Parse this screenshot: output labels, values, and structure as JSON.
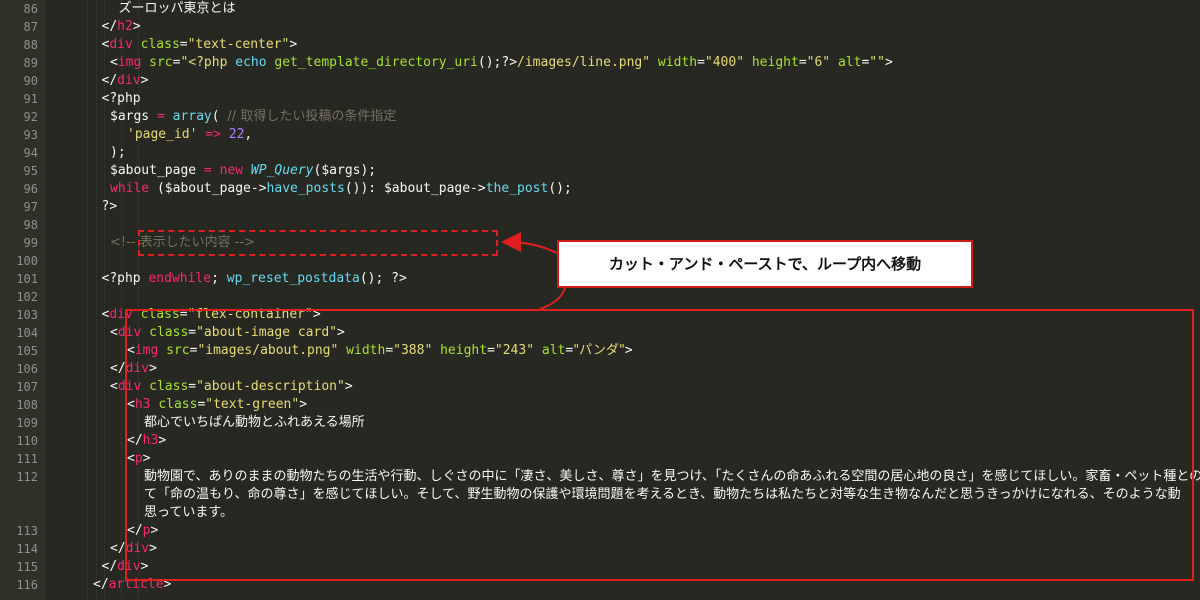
{
  "editor": {
    "lines": [
      {
        "n": "86",
        "indent": 9,
        "tokens": [
          {
            "t": "text",
            "v": "ズーロッパ東京とは"
          }
        ]
      },
      {
        "n": "87",
        "indent": 7,
        "tokens": [
          {
            "t": "punct",
            "v": "</"
          },
          {
            "t": "tag",
            "v": "h2"
          },
          {
            "t": "punct",
            "v": ">"
          }
        ]
      },
      {
        "n": "88",
        "indent": 7,
        "tokens": [
          {
            "t": "punct",
            "v": "<"
          },
          {
            "t": "tag",
            "v": "div"
          },
          {
            "t": "punct",
            "v": " "
          },
          {
            "t": "attr",
            "v": "class"
          },
          {
            "t": "punct",
            "v": "="
          },
          {
            "t": "str",
            "v": "\"text-center\""
          },
          {
            "t": "punct",
            "v": ">"
          }
        ]
      },
      {
        "n": "89",
        "indent": 8,
        "tokens": [
          {
            "t": "punct",
            "v": "<"
          },
          {
            "t": "tag",
            "v": "img"
          },
          {
            "t": "punct",
            "v": " "
          },
          {
            "t": "attr",
            "v": "src"
          },
          {
            "t": "punct",
            "v": "="
          },
          {
            "t": "str",
            "v": "\"<?php "
          },
          {
            "t": "fn",
            "v": "echo"
          },
          {
            "t": "punct",
            "v": " "
          },
          {
            "t": "attr",
            "v": "get_template_directory_uri"
          },
          {
            "t": "punct",
            "v": "();?>"
          },
          {
            "t": "str",
            "v": "/images/line.png\""
          },
          {
            "t": "punct",
            "v": " "
          },
          {
            "t": "attr",
            "v": "width"
          },
          {
            "t": "punct",
            "v": "="
          },
          {
            "t": "str",
            "v": "\"400\""
          },
          {
            "t": "punct",
            "v": " "
          },
          {
            "t": "attr",
            "v": "height"
          },
          {
            "t": "punct",
            "v": "="
          },
          {
            "t": "str",
            "v": "\"6\""
          },
          {
            "t": "punct",
            "v": " "
          },
          {
            "t": "attr",
            "v": "alt"
          },
          {
            "t": "punct",
            "v": "="
          },
          {
            "t": "str",
            "v": "\"\""
          },
          {
            "t": "punct",
            "v": ">"
          }
        ]
      },
      {
        "n": "90",
        "indent": 7,
        "tokens": [
          {
            "t": "punct",
            "v": "</"
          },
          {
            "t": "tag",
            "v": "div"
          },
          {
            "t": "punct",
            "v": ">"
          }
        ]
      },
      {
        "n": "91",
        "indent": 7,
        "tokens": [
          {
            "t": "php",
            "v": "<?php"
          }
        ]
      },
      {
        "n": "92",
        "indent": 8,
        "tokens": [
          {
            "t": "var",
            "v": "$args"
          },
          {
            "t": "punct",
            "v": " "
          },
          {
            "t": "kw",
            "v": "="
          },
          {
            "t": "punct",
            "v": " "
          },
          {
            "t": "fn",
            "v": "array"
          },
          {
            "t": "punct",
            "v": "( "
          },
          {
            "t": "comment",
            "v": "// 取得したい投稿の条件指定"
          }
        ]
      },
      {
        "n": "93",
        "indent": 10,
        "tokens": [
          {
            "t": "str",
            "v": "'page_id'"
          },
          {
            "t": "punct",
            "v": " "
          },
          {
            "t": "kw",
            "v": "=>"
          },
          {
            "t": "punct",
            "v": " "
          },
          {
            "t": "num",
            "v": "22"
          },
          {
            "t": "punct",
            "v": ","
          }
        ]
      },
      {
        "n": "94",
        "indent": 8,
        "tokens": [
          {
            "t": "punct",
            "v": ");"
          }
        ]
      },
      {
        "n": "95",
        "indent": 8,
        "tokens": [
          {
            "t": "var",
            "v": "$about_page"
          },
          {
            "t": "punct",
            "v": " "
          },
          {
            "t": "kw",
            "v": "="
          },
          {
            "t": "punct",
            "v": " "
          },
          {
            "t": "kw",
            "v": "new"
          },
          {
            "t": "punct",
            "v": " "
          },
          {
            "t": "cls",
            "v": "WP_Query"
          },
          {
            "t": "punct",
            "v": "($args);"
          }
        ]
      },
      {
        "n": "96",
        "indent": 8,
        "tokens": [
          {
            "t": "kw",
            "v": "while"
          },
          {
            "t": "punct",
            "v": " ($about_page->"
          },
          {
            "t": "fn",
            "v": "have_posts"
          },
          {
            "t": "punct",
            "v": "()): $about_page->"
          },
          {
            "t": "fn",
            "v": "the_post"
          },
          {
            "t": "punct",
            "v": "();"
          }
        ]
      },
      {
        "n": "97",
        "indent": 7,
        "tokens": [
          {
            "t": "php",
            "v": "?>"
          }
        ]
      },
      {
        "n": "98",
        "indent": 0,
        "tokens": []
      },
      {
        "n": "99",
        "indent": 8,
        "tokens": [
          {
            "t": "comment",
            "v": "<!-- 表示したい内容 -->"
          }
        ]
      },
      {
        "n": "100",
        "indent": 0,
        "tokens": []
      },
      {
        "n": "101",
        "indent": 7,
        "tokens": [
          {
            "t": "php",
            "v": "<?php "
          },
          {
            "t": "kw",
            "v": "endwhile"
          },
          {
            "t": "punct",
            "v": "; "
          },
          {
            "t": "fn",
            "v": "wp_reset_postdata"
          },
          {
            "t": "punct",
            "v": "(); ?>"
          }
        ]
      },
      {
        "n": "102",
        "indent": 0,
        "tokens": []
      },
      {
        "n": "103",
        "indent": 7,
        "tokens": [
          {
            "t": "punct",
            "v": "<"
          },
          {
            "t": "tag",
            "v": "div"
          },
          {
            "t": "punct",
            "v": " "
          },
          {
            "t": "attr",
            "v": "class"
          },
          {
            "t": "punct",
            "v": "="
          },
          {
            "t": "str",
            "v": "\"flex-container\""
          },
          {
            "t": "punct",
            "v": ">"
          }
        ]
      },
      {
        "n": "104",
        "indent": 8,
        "tokens": [
          {
            "t": "punct",
            "v": "<"
          },
          {
            "t": "tag",
            "v": "div"
          },
          {
            "t": "punct",
            "v": " "
          },
          {
            "t": "attr",
            "v": "class"
          },
          {
            "t": "punct",
            "v": "="
          },
          {
            "t": "str",
            "v": "\"about-image card\""
          },
          {
            "t": "punct",
            "v": ">"
          }
        ]
      },
      {
        "n": "105",
        "indent": 10,
        "tokens": [
          {
            "t": "punct",
            "v": "<"
          },
          {
            "t": "tag",
            "v": "img"
          },
          {
            "t": "punct",
            "v": " "
          },
          {
            "t": "attr",
            "v": "src"
          },
          {
            "t": "punct",
            "v": "="
          },
          {
            "t": "str",
            "v": "\"images/about.png\""
          },
          {
            "t": "punct",
            "v": " "
          },
          {
            "t": "attr",
            "v": "width"
          },
          {
            "t": "punct",
            "v": "="
          },
          {
            "t": "str",
            "v": "\"388\""
          },
          {
            "t": "punct",
            "v": " "
          },
          {
            "t": "attr",
            "v": "height"
          },
          {
            "t": "punct",
            "v": "="
          },
          {
            "t": "str",
            "v": "\"243\""
          },
          {
            "t": "punct",
            "v": " "
          },
          {
            "t": "attr",
            "v": "alt"
          },
          {
            "t": "punct",
            "v": "="
          },
          {
            "t": "str",
            "v": "\"パンダ\""
          },
          {
            "t": "punct",
            "v": ">"
          }
        ]
      },
      {
        "n": "106",
        "indent": 8,
        "tokens": [
          {
            "t": "punct",
            "v": "</"
          },
          {
            "t": "tag",
            "v": "div"
          },
          {
            "t": "punct",
            "v": ">"
          }
        ]
      },
      {
        "n": "107",
        "indent": 8,
        "tokens": [
          {
            "t": "punct",
            "v": "<"
          },
          {
            "t": "tag",
            "v": "div"
          },
          {
            "t": "punct",
            "v": " "
          },
          {
            "t": "attr",
            "v": "class"
          },
          {
            "t": "punct",
            "v": "="
          },
          {
            "t": "str",
            "v": "\"about-description\""
          },
          {
            "t": "punct",
            "v": ">"
          }
        ]
      },
      {
        "n": "108",
        "indent": 10,
        "tokens": [
          {
            "t": "punct",
            "v": "<"
          },
          {
            "t": "tag",
            "v": "h3"
          },
          {
            "t": "punct",
            "v": " "
          },
          {
            "t": "attr",
            "v": "class"
          },
          {
            "t": "punct",
            "v": "="
          },
          {
            "t": "str",
            "v": "\"text-green\""
          },
          {
            "t": "punct",
            "v": ">"
          }
        ]
      },
      {
        "n": "109",
        "indent": 12,
        "tokens": [
          {
            "t": "text",
            "v": "都心でいちばん動物とふれあえる場所"
          }
        ]
      },
      {
        "n": "110",
        "indent": 10,
        "tokens": [
          {
            "t": "punct",
            "v": "</"
          },
          {
            "t": "tag",
            "v": "h3"
          },
          {
            "t": "punct",
            "v": ">"
          }
        ]
      },
      {
        "n": "111",
        "indent": 10,
        "tokens": [
          {
            "t": "punct",
            "v": "<"
          },
          {
            "t": "tag",
            "v": "p"
          },
          {
            "t": "punct",
            "v": ">"
          }
        ]
      },
      {
        "n": "112",
        "indent": 12,
        "tokens": [
          {
            "t": "text",
            "v": "動物園で、ありのままの動物たちの生活や行動、しぐさの中に「凄さ、美しさ、尊さ」を見つけ、「たくさんの命あふれる空間の居心地の良さ」を感じてほしい。家畜・ペット種との"
          }
        ]
      },
      {
        "n": "",
        "indent": 12,
        "tokens": [
          {
            "t": "text",
            "v": "て「命の温もり、命の尊さ」を感じてほしい。そして、野生動物の保護や環境問題を考えるとき、動物たちは私たちと対等な生き物なんだと思うきっかけになれる、そのような動"
          }
        ]
      },
      {
        "n": "",
        "indent": 12,
        "tokens": [
          {
            "t": "text",
            "v": "思っています。"
          }
        ]
      },
      {
        "n": "113",
        "indent": 10,
        "tokens": [
          {
            "t": "punct",
            "v": "</"
          },
          {
            "t": "tag",
            "v": "p"
          },
          {
            "t": "punct",
            "v": ">"
          }
        ]
      },
      {
        "n": "114",
        "indent": 8,
        "tokens": [
          {
            "t": "punct",
            "v": "</"
          },
          {
            "t": "tag",
            "v": "div"
          },
          {
            "t": "punct",
            "v": ">"
          }
        ]
      },
      {
        "n": "115",
        "indent": 7,
        "tokens": [
          {
            "t": "punct",
            "v": "</"
          },
          {
            "t": "tag",
            "v": "div"
          },
          {
            "t": "punct",
            "v": ">"
          }
        ]
      },
      {
        "n": "116",
        "indent": 6,
        "tokens": [
          {
            "t": "punct",
            "v": "</"
          },
          {
            "t": "tag",
            "v": "article"
          },
          {
            "t": "punct",
            "v": ">"
          }
        ]
      }
    ]
  },
  "annotation": {
    "callout_text": "カット・アンド・ペーストで、ループ内へ移動",
    "highlight_color": "#e02020"
  },
  "theme": {
    "background": "#272822",
    "tag": "#f92672",
    "attribute": "#a6e22e",
    "string": "#e6db74",
    "function": "#66d9ef",
    "number": "#ae81ff",
    "comment": "#75715e"
  }
}
